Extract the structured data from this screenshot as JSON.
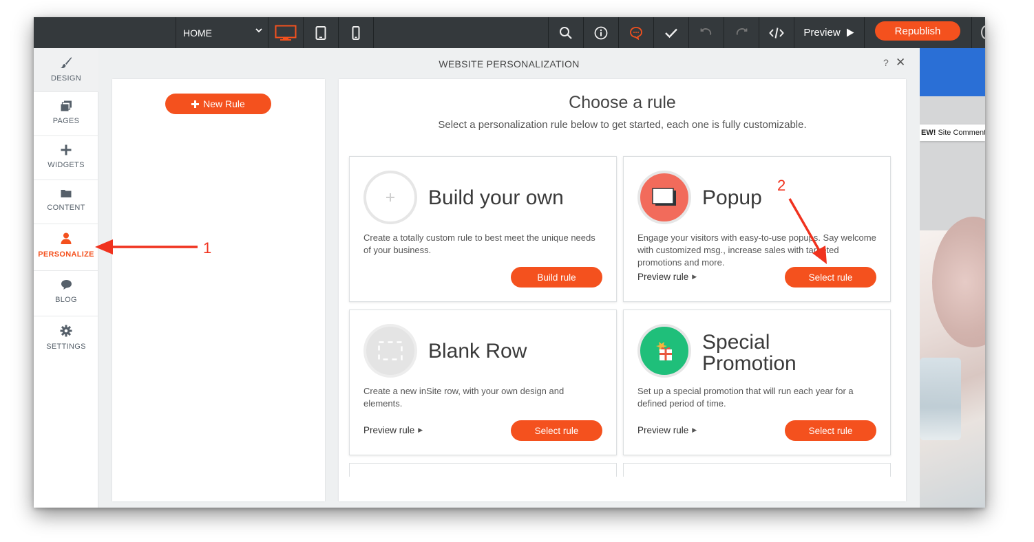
{
  "topbar": {
    "page_selector": "HOME",
    "devices": [
      "desktop-icon",
      "tablet-icon",
      "mobile-icon"
    ],
    "active_device": "desktop",
    "tools": [
      "search-icon",
      "info-icon",
      "comments-icon",
      "check-icon",
      "undo-icon",
      "redo-icon",
      "code-icon"
    ],
    "preview_label": "Preview",
    "republish_label": "Republish"
  },
  "sidebar": {
    "items": [
      {
        "label": "DESIGN",
        "icon": "brush-icon"
      },
      {
        "label": "PAGES",
        "icon": "pages-icon"
      },
      {
        "label": "WIDGETS",
        "icon": "plus-icon"
      },
      {
        "label": "CONTENT",
        "icon": "folder-icon"
      },
      {
        "label": "PERSONALIZE",
        "icon": "person-icon"
      },
      {
        "label": "BLOG",
        "icon": "speech-bubble-icon"
      },
      {
        "label": "SETTINGS",
        "icon": "gear-icon"
      }
    ],
    "active": "PERSONALIZE"
  },
  "panel": {
    "title": "WEBSITE PERSONALIZATION",
    "help": "?",
    "close": "✕",
    "new_rule_label": "New Rule",
    "choose_title": "Choose a rule",
    "choose_subtitle": "Select a personalization rule below to get started, each one is fully customizable.",
    "cards": [
      {
        "title": "Build your own",
        "description": "Create a totally custom rule to best meet the unique needs of your business.",
        "button": "Build rule"
      },
      {
        "title": "Popup",
        "description": "Engage your visitors with easy-to-use popups. Say welcome with customized msg., increase sales with targeted promotions and more.",
        "preview": "Preview rule",
        "button": "Select rule"
      },
      {
        "title": "Blank Row",
        "description": "Create a new inSite row, with your own design and elements.",
        "preview": "Preview rule",
        "button": "Select rule"
      },
      {
        "title_line1": "Special",
        "title_line2": "Promotion",
        "description": "Set up a special promotion that will run each year for a defined period of time.",
        "preview": "Preview rule",
        "button": "Select rule"
      }
    ]
  },
  "site_preview": {
    "strip_bold": "EW!",
    "strip_text": " Site Comments"
  },
  "annotations": {
    "label1": "1",
    "label2": "2"
  },
  "colors": {
    "accent": "#f4511e",
    "topbar": "#34393c",
    "popup_circle": "#f26b5b",
    "promo_circle": "#1fbf7a",
    "annotation": "#f0321e"
  }
}
